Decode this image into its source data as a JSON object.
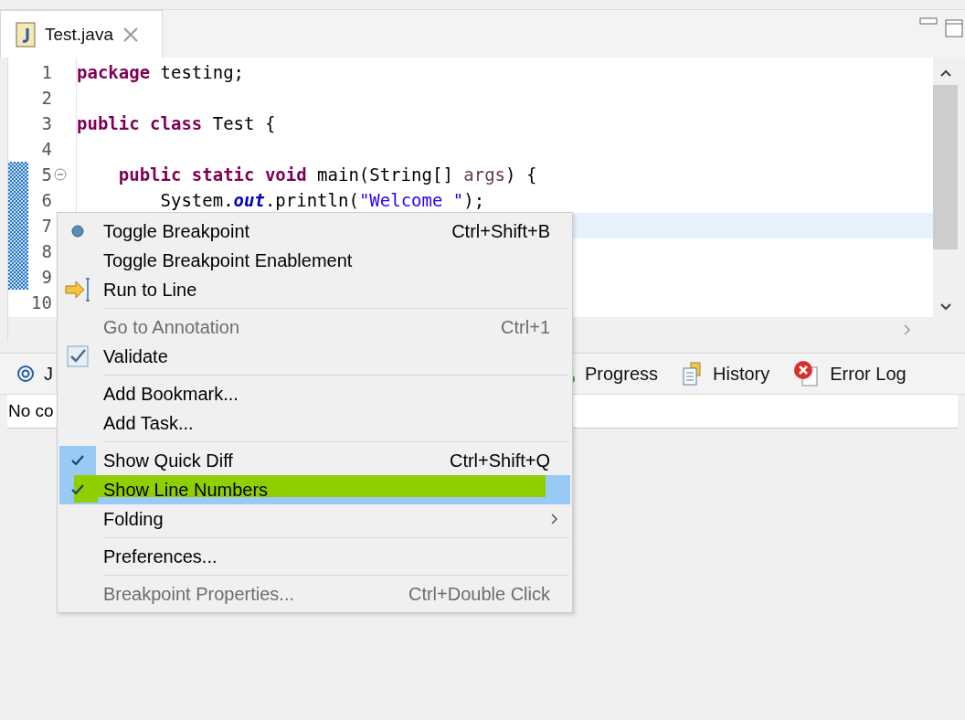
{
  "editor_tab": {
    "title": "Test.java",
    "selected": true
  },
  "code_lines": [
    {
      "number": "1",
      "foldable": false,
      "changed": false,
      "current": false,
      "tokens": [
        {
          "kind": "keyword",
          "text": "package"
        },
        {
          "kind": "plain",
          "text": " testing;"
        }
      ]
    },
    {
      "number": "2",
      "foldable": false,
      "changed": false,
      "current": false
    },
    {
      "number": "3",
      "foldable": false,
      "changed": false,
      "current": false,
      "tokens": [
        {
          "kind": "keyword",
          "text": "public class"
        },
        {
          "kind": "plain",
          "text": " Test {"
        }
      ]
    },
    {
      "number": "4",
      "foldable": false,
      "changed": false,
      "current": false
    },
    {
      "number": "5",
      "foldable": true,
      "changed": true,
      "current": false,
      "tokens": [
        {
          "kind": "keyword",
          "text": "    public static void"
        },
        {
          "kind": "plain",
          "text": " main(String[] "
        },
        {
          "kind": "param",
          "text": "args"
        },
        {
          "kind": "plain",
          "text": ") {"
        }
      ]
    },
    {
      "number": "6",
      "foldable": false,
      "changed": true,
      "current": false,
      "tokens": [
        {
          "kind": "plain",
          "text": "        System."
        },
        {
          "kind": "field",
          "text": "out"
        },
        {
          "kind": "plain",
          "text": ".println("
        },
        {
          "kind": "string",
          "text": "\"Welcome \""
        },
        {
          "kind": "plain",
          "text": ");"
        }
      ]
    },
    {
      "number": "7",
      "foldable": false,
      "changed": true,
      "current": true
    },
    {
      "number": "8",
      "foldable": false,
      "changed": true,
      "current": false
    },
    {
      "number": "9",
      "foldable": false,
      "changed": true,
      "current": false
    },
    {
      "number": "10",
      "foldable": false,
      "changed": false,
      "current": false
    }
  ],
  "bottom_tabs": [
    {
      "label": "J"
    },
    {
      "label": "Progress"
    },
    {
      "label": "History"
    },
    {
      "label": "Error Log"
    }
  ],
  "bottom_content": "No co",
  "context_menu": [
    {
      "kind": "breakpoint",
      "label": "Toggle Breakpoint",
      "shortcut": "Ctrl+Shift+B",
      "disabled": false,
      "checked": false,
      "selected": false
    },
    {
      "kind": "item",
      "label": "Toggle Breakpoint Enablement",
      "disabled": false,
      "checked": false,
      "selected": false
    },
    {
      "kind": "run",
      "label": "Run to Line",
      "disabled": false,
      "checked": false,
      "selected": false
    },
    {
      "kind": "separator"
    },
    {
      "kind": "item",
      "label": "Go to Annotation",
      "shortcut": "Ctrl+1",
      "disabled": true,
      "checked": false,
      "selected": false
    },
    {
      "kind": "validate",
      "label": "Validate",
      "disabled": false,
      "checked": false,
      "selected": false
    },
    {
      "kind": "separator"
    },
    {
      "kind": "item",
      "label": "Add Bookmark...",
      "disabled": false,
      "checked": false,
      "selected": false
    },
    {
      "kind": "item",
      "label": "Add Task...",
      "disabled": false,
      "checked": false,
      "selected": false
    },
    {
      "kind": "separator"
    },
    {
      "kind": "item",
      "label": "Show Quick Diff",
      "shortcut": "Ctrl+Shift+Q",
      "disabled": false,
      "checked": true,
      "selected": false
    },
    {
      "kind": "item",
      "label": "Show Line Numbers",
      "disabled": false,
      "checked": true,
      "selected": true,
      "highlighted": true
    },
    {
      "kind": "item",
      "label": "Folding",
      "submenu": true,
      "disabled": false,
      "checked": false,
      "selected": false
    },
    {
      "kind": "separator"
    },
    {
      "kind": "item",
      "label": "Preferences...",
      "disabled": false,
      "checked": false,
      "selected": false
    },
    {
      "kind": "separator"
    },
    {
      "kind": "item",
      "label": "Breakpoint Properties...",
      "shortcut": "Ctrl+Double Click",
      "disabled": true,
      "checked": false,
      "selected": false
    }
  ]
}
